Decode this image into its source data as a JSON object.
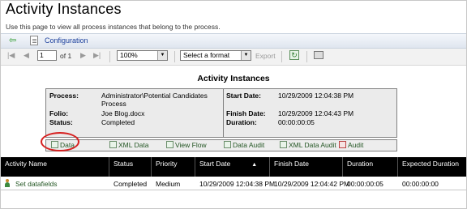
{
  "page": {
    "title": "Activity Instances",
    "subtitle": "Use this page to view all process instances that belong to the process."
  },
  "nav": {
    "back_icon": "back-arrow-icon",
    "config_label": "Configuration"
  },
  "toolbar": {
    "page_value": "1",
    "page_of": "of 1",
    "zoom": "100%",
    "format": "Select a format",
    "export_label": "Export"
  },
  "report": {
    "title": "Activity Instances",
    "process_label": "Process:",
    "process_value": "Administrator\\Potential Candidates Process",
    "folio_label": "Folio:",
    "folio_value": "Joe Blog.docx",
    "status_label": "Status:",
    "status_value": "Completed",
    "start_label": "Start Date:",
    "start_value": "10/29/2009 12:04:38 PM",
    "finish_label": "Finish Date:",
    "finish_value": "10/29/2009 12:04:43 PM",
    "duration_label": "Duration:",
    "duration_value": "00:00:00:05"
  },
  "actions": [
    "Data",
    "XML Data",
    "View Flow",
    "Data Audit",
    "XML Data Audit",
    "Audit"
  ],
  "grid": {
    "headers": [
      "Activity Name",
      "Status",
      "Priority",
      "Start Date",
      "Finish Date",
      "Duration",
      "Expected Duration"
    ],
    "rows": [
      [
        "Set datafields",
        "Completed",
        "Medium",
        "10/29/2009 12:04:38 PM",
        "10/29/2009 12:04:42 PM",
        "00:00:00:05",
        "00:00:00:00"
      ]
    ]
  }
}
